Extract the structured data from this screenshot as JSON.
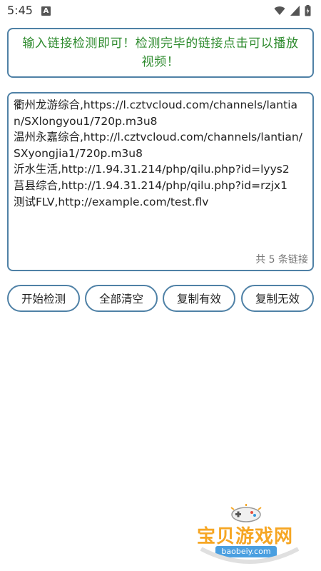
{
  "status_bar": {
    "time": "5:45",
    "notification_icon": "A",
    "icons": [
      "wifi-icon",
      "signal-icon",
      "battery-icon"
    ]
  },
  "banner": {
    "text": "输入链接检测即可！检测完毕的链接点击可以播放视频！"
  },
  "links_input": {
    "value": "衢州龙游综合,https://l.cztvcloud.com/channels/lantian/SXlongyou1/720p.m3u8\n温州永嘉综合,http://l.cztvcloud.com/channels/lantian/SXyongjia1/720p.m3u8\n沂水生活,http://1.94.31.214/php/qilu.php?id=lyys2\n莒县综合,http://1.94.31.214/php/qilu.php?id=rzjx1\n测试FLV,http://example.com/test.flv",
    "count_label": "共 5 条链接"
  },
  "actions": {
    "start_label": "开始检测",
    "clear_label": "全部清空",
    "copy_valid_label": "复制有效",
    "copy_invalid_label": "复制无效"
  },
  "watermark": {
    "title": "宝贝游戏网",
    "url": "baobeiy.com"
  },
  "colors": {
    "border": "#4f81a6",
    "banner_text": "#2e8b2e",
    "watermark": "#f6a623"
  }
}
